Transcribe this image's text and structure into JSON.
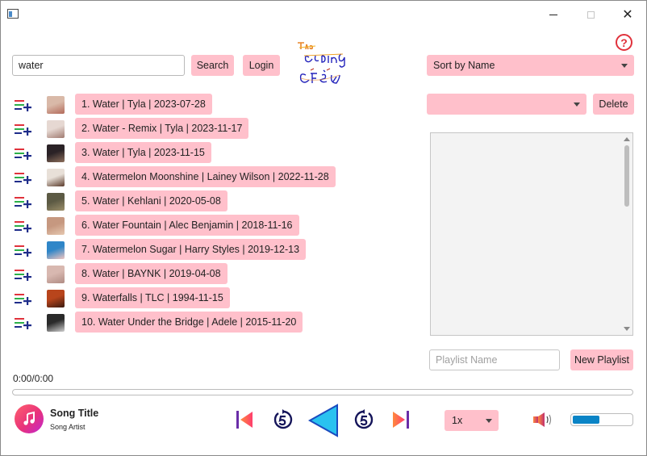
{
  "search": {
    "value": "water",
    "button_label": "Search"
  },
  "login_label": "Login",
  "sort": {
    "selected": "Sort by Name"
  },
  "delete_label": "Delete",
  "songs": [
    {
      "label": "1. Water | Tyla | 2023-07-28",
      "thumb": "#d9b9a8",
      "thumb2": "#b36a5a"
    },
    {
      "label": "2. Water - Remix | Tyla | 2023-11-17",
      "thumb": "#e6d8d2",
      "thumb2": "#a07a70"
    },
    {
      "label": "3. Water | Tyla | 2023-11-15",
      "thumb": "#2a2226",
      "thumb2": "#8d6f5c"
    },
    {
      "label": "4. Watermelon Moonshine | Lainey Wilson | 2022-11-28",
      "thumb": "#e8e0d8",
      "thumb2": "#5a3a2a"
    },
    {
      "label": "5. Water | Kehlani | 2020-05-08",
      "thumb": "#5c5a44",
      "thumb2": "#9c8f6a"
    },
    {
      "label": "6. Water Fountain | Alec Benjamin | 2018-11-16",
      "thumb": "#c69880",
      "thumb2": "#e6c8b0"
    },
    {
      "label": "7. Watermelon Sugar | Harry Styles | 2019-12-13",
      "thumb": "#2f86c8",
      "thumb2": "#f2c6c0"
    },
    {
      "label": "8. Water | BAYNK | 2019-04-08",
      "thumb": "#d8b8b0",
      "thumb2": "#b08c84"
    },
    {
      "label": "9. Waterfalls | TLC | 1994-11-15",
      "thumb": "#b8451c",
      "thumb2": "#3a1a10"
    },
    {
      "label": "10. Water Under the Bridge | Adele | 2015-11-20",
      "thumb": "#2a2a2a",
      "thumb2": "#cfcfcf"
    }
  ],
  "playlist": {
    "placeholder": "Playlist Name",
    "new_label": "New Playlist"
  },
  "player": {
    "time": "0:00/0:00",
    "song_title": "Song Title",
    "song_artist": "Song Artist",
    "speed": "1x",
    "volume_level": 0.45
  },
  "colors": {
    "pink": "#ffc0cb",
    "play_blue": "#29c2f0",
    "volume_blue": "#0a84c6",
    "accent_red": "#e0323c"
  }
}
